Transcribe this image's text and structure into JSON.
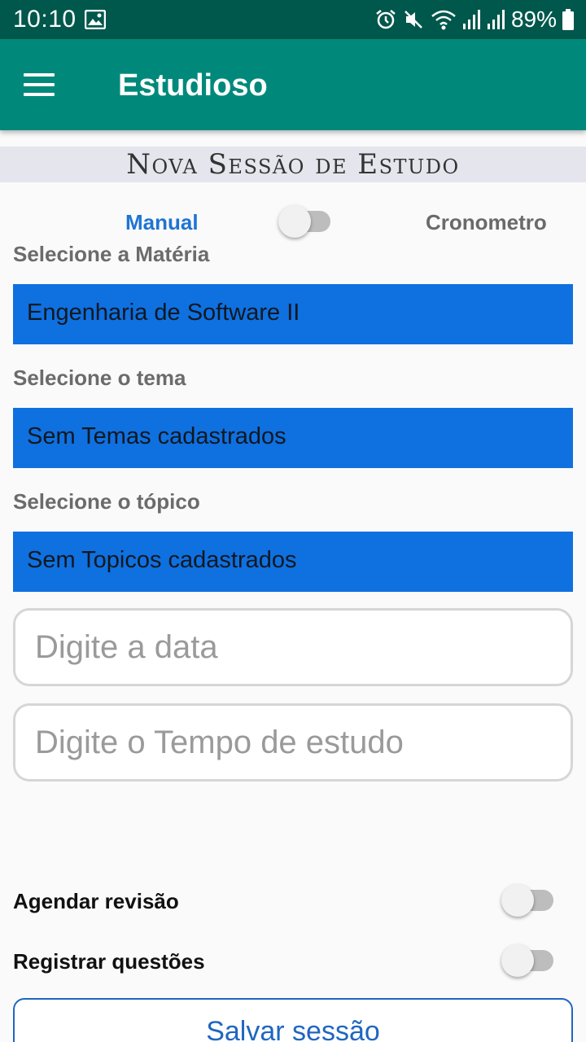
{
  "status_bar": {
    "time": "10:10",
    "battery": "89%",
    "icons": [
      "image-icon",
      "alarm-icon",
      "mute-icon",
      "wifi-icon",
      "signal-icon",
      "signal-icon",
      "battery-icon"
    ]
  },
  "app_bar": {
    "title": "Estudioso",
    "menu_icon": "hamburger-menu-icon"
  },
  "section_header": "Nova Sessão de Estudo",
  "mode_toggle": {
    "left_label": "Manual",
    "right_label": "Cronometro",
    "state": "off"
  },
  "form": {
    "subject_label": "Selecione a Matéria",
    "subject_value": "Engenharia de Software II",
    "theme_label": "Selecione o tema",
    "theme_value": "Sem Temas cadastrados",
    "topic_label": "Selecione o tópico",
    "topic_value": "Sem Topicos cadastrados",
    "date_placeholder": "Digite a data",
    "time_placeholder": "Digite o Tempo de estudo"
  },
  "options": {
    "schedule_review_label": "Agendar revisão",
    "schedule_review_state": "off",
    "register_questions_label": "Registrar questões",
    "register_questions_state": "off"
  },
  "save_button": "Salvar sessão",
  "colors": {
    "status_bar": "#00574b",
    "app_bar": "#00897b",
    "picker": "#0f70e0",
    "accent_text": "#1f74d3"
  }
}
